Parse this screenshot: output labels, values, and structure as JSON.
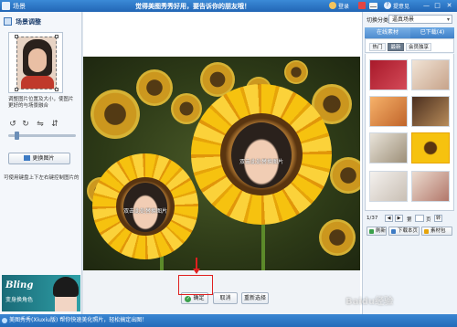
{
  "window": {
    "title": "场景",
    "marquee": "觉得美图秀秀好用，要告诉你的朋友哦！",
    "login_label": "登录",
    "help_label": "提意见",
    "minimize_glyph": "—",
    "maximize_glyph": "□",
    "close_glyph": "✕"
  },
  "left_panel": {
    "title": "场景调整",
    "hint": "调整图片位置及大小，使图片更好的与场景融合",
    "change_button": "更换图片",
    "tip": "可使用键盘上下左右键控制图片的",
    "banner": {
      "brand": "Bling",
      "subtitle": "变身换角色"
    }
  },
  "canvas": {
    "face_labels": [
      "双击此处替换图片",
      "双击此处替换图片"
    ],
    "buttons": {
      "ok": "确定",
      "cancel": "取消",
      "reset": "重新选择"
    }
  },
  "right_panel": {
    "category_label": "切换分类",
    "category_value": "逼真场景",
    "tabs": {
      "online": "在线素材",
      "downloaded": "已下载(4)"
    },
    "subtabs": [
      "热门",
      "最新",
      "会员独享"
    ],
    "active_subtab": "最新",
    "pager": {
      "count": "1/37",
      "prev": "◀",
      "next": "▶",
      "page_word": "页",
      "go": "转"
    },
    "actions": {
      "refresh": "刷新",
      "download_page": "下载本页",
      "material_pack": "素材包"
    }
  },
  "statusbar": {
    "text": "美图秀秀(Xiuxiu版) 帮你快速美化照片，轻松搞定出图！"
  },
  "watermark": "Baidu经验",
  "colors": {
    "titlebar": "#2266b5",
    "accent_red": "#e02020",
    "ok_green": "#3aa04b",
    "sunflower": "#f6c20f"
  }
}
